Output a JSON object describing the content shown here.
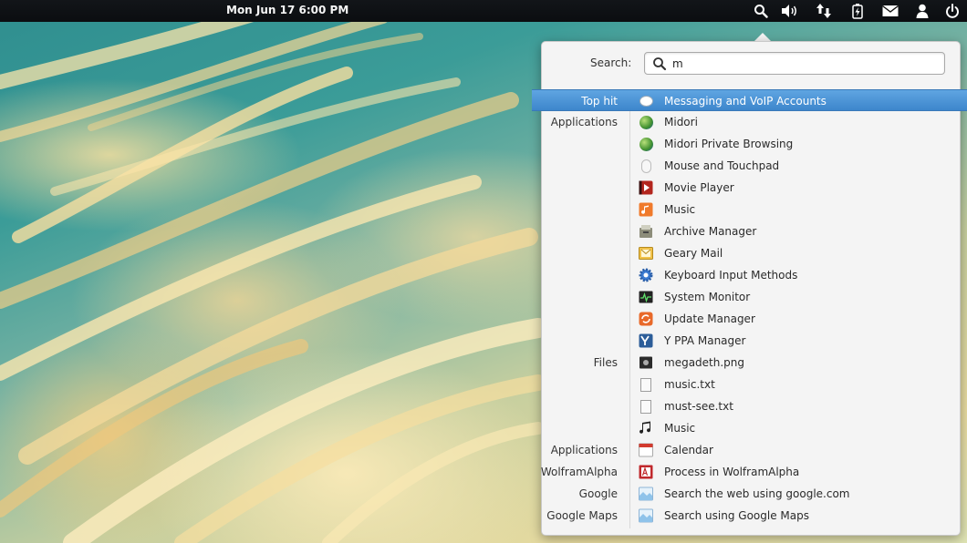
{
  "topbar": {
    "clock": "Mon Jun 17  6:00 PM",
    "indicators": [
      "search-icon",
      "volume-icon",
      "network-icon",
      "battery-icon",
      "mail-icon",
      "user-icon",
      "power-icon"
    ]
  },
  "search": {
    "label": "Search:",
    "value": "m"
  },
  "results": [
    {
      "category": "Top hit",
      "label": "Messaging and VoIP Accounts",
      "icon": "messaging-icon",
      "selected": true
    },
    {
      "category": "Applications",
      "label": "Midori",
      "icon": "midori-icon"
    },
    {
      "category": "",
      "label": "Midori Private Browsing",
      "icon": "midori-private-icon"
    },
    {
      "category": "",
      "label": "Mouse and Touchpad",
      "icon": "mouse-icon"
    },
    {
      "category": "",
      "label": "Movie Player",
      "icon": "movie-player-icon"
    },
    {
      "category": "",
      "label": "Music",
      "icon": "music-app-icon"
    },
    {
      "category": "",
      "label": "Archive Manager",
      "icon": "archive-manager-icon"
    },
    {
      "category": "",
      "label": "Geary Mail",
      "icon": "geary-mail-icon"
    },
    {
      "category": "",
      "label": "Keyboard Input Methods",
      "icon": "keyboard-input-icon"
    },
    {
      "category": "",
      "label": "System Monitor",
      "icon": "system-monitor-icon"
    },
    {
      "category": "",
      "label": "Update Manager",
      "icon": "update-manager-icon"
    },
    {
      "category": "",
      "label": "Y PPA Manager",
      "icon": "ppa-manager-icon"
    },
    {
      "category": "Files",
      "label": "megadeth.png",
      "icon": "image-file-icon"
    },
    {
      "category": "",
      "label": "music.txt",
      "icon": "text-file-icon"
    },
    {
      "category": "",
      "label": "must-see.txt",
      "icon": "text-file-icon"
    },
    {
      "category": "",
      "label": "Music",
      "icon": "music-folder-icon"
    },
    {
      "category": "Applications",
      "label": "Calendar",
      "icon": "calendar-icon"
    },
    {
      "category": "WolframAlpha",
      "label": "Process in WolframAlpha",
      "icon": "wolframalpha-icon"
    },
    {
      "category": "Google",
      "label": "Search the web using google.com",
      "icon": "web-search-icon"
    },
    {
      "category": "Google Maps",
      "label": "Search using Google Maps",
      "icon": "maps-search-icon"
    }
  ],
  "colors": {
    "topbar": "#0b0d10",
    "selection": "#3d86cc",
    "panel": "#f4f4f4"
  }
}
